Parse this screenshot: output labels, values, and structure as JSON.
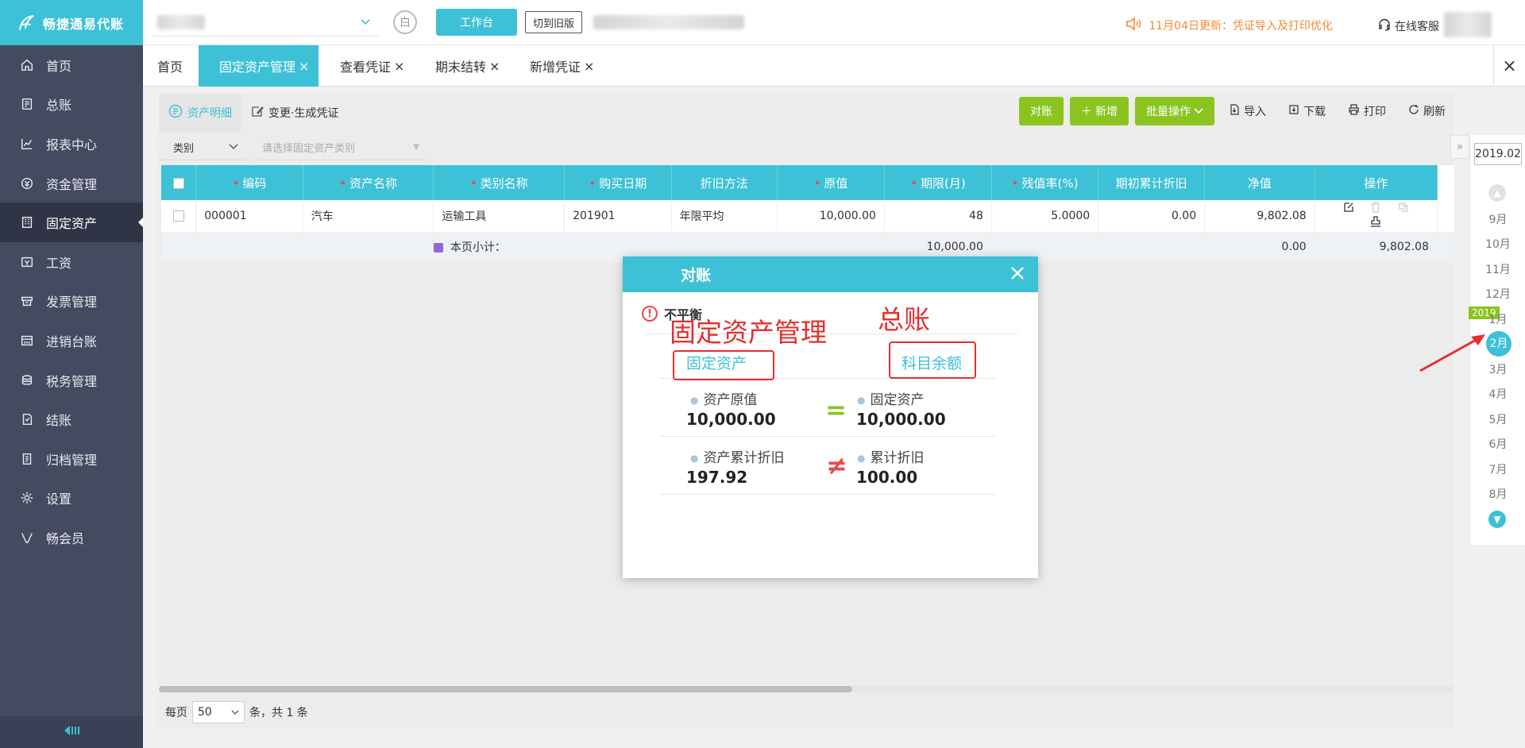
{
  "app": {
    "logo_text": "畅捷通易代账"
  },
  "sidebar": {
    "items": [
      {
        "label": "首页",
        "icon": "home-icon"
      },
      {
        "label": "总账",
        "icon": "ledger-icon"
      },
      {
        "label": "报表中心",
        "icon": "chart-icon"
      },
      {
        "label": "资金管理",
        "icon": "funds-icon"
      },
      {
        "label": "固定资产",
        "icon": "building-icon",
        "active": true
      },
      {
        "label": "工资",
        "icon": "salary-icon"
      },
      {
        "label": "发票管理",
        "icon": "invoice-icon"
      },
      {
        "label": "进销台账",
        "icon": "inventory-icon"
      },
      {
        "label": "税务管理",
        "icon": "tax-icon"
      },
      {
        "label": "结账",
        "icon": "checkout-icon"
      },
      {
        "label": "归档管理",
        "icon": "archive-icon"
      },
      {
        "label": "设置",
        "icon": "gear-icon"
      },
      {
        "label": "畅会员",
        "icon": "vip-icon"
      }
    ]
  },
  "header": {
    "circle_btn": "白",
    "workbench": "工作台",
    "old_version": "切到旧版",
    "notice": "11月04日更新：凭证导入及打印优化",
    "service": "在线客服"
  },
  "tabs": [
    {
      "label": "首页",
      "closable": false
    },
    {
      "label": "固定资产管理",
      "closable": true,
      "active": true
    },
    {
      "label": "查看凭证",
      "closable": true
    },
    {
      "label": "期末结转",
      "closable": true
    },
    {
      "label": "新增凭证",
      "closable": true
    }
  ],
  "subtabs": {
    "detail": "资产明细",
    "change": "变更·生成凭证"
  },
  "toolbar": {
    "reconcile": "对账",
    "add": "新增",
    "batch": "批量操作",
    "import": "导入",
    "download": "下载",
    "print": "打印",
    "refresh": "刷新"
  },
  "filter": {
    "type": "类别",
    "placeholder": "请选择固定资产类别"
  },
  "table": {
    "columns": [
      "编码",
      "资产名称",
      "类别名称",
      "购买日期",
      "折旧方法",
      "原值",
      "期限(月)",
      "残值率(%)",
      "期初累计折旧",
      "净值",
      "操作"
    ],
    "rows": [
      {
        "code": "000001",
        "name": "汽车",
        "category": "运输工具",
        "date": "201901",
        "method": "年限平均",
        "original": "10,000.00",
        "term": "48",
        "residual": "5.0000",
        "opening_dep": "0.00",
        "net": "9,802.08"
      }
    ],
    "subtotal": {
      "label": "本页小计：",
      "original": "10,000.00",
      "opening_dep": "0.00",
      "net": "9,802.08"
    }
  },
  "pager": {
    "prefix": "每页",
    "size": "50",
    "suffix": "条，共 1 条"
  },
  "period": {
    "current": "2019.02",
    "year_badge": "2019",
    "months": [
      "9月",
      "10月",
      "11月",
      "12月",
      "1月",
      "2月",
      "3月",
      "4月",
      "5月",
      "6月",
      "7月",
      "8月"
    ],
    "current_month": "2月"
  },
  "modal": {
    "title": "对账",
    "status": "不平衡",
    "left_head": "固定资产",
    "right_head": "科目余额",
    "rows": [
      {
        "left_label": "资产原值",
        "left_value": "10,000.00",
        "sign": "=",
        "right_label": "固定资产",
        "right_value": "10,000.00"
      },
      {
        "left_label": "资产累计折旧",
        "left_value": "197.92",
        "sign": "≠",
        "right_label": "累计折旧",
        "right_value": "100.00"
      }
    ]
  },
  "annotations": {
    "left": "固定资产管理",
    "right": "总账"
  },
  "colors": {
    "accent": "#3dc1d6",
    "sidebar": "#444a5f",
    "green": "#8bc41f",
    "warning": "#f28a32",
    "danger": "#e84a4a",
    "annotation": "#e62e2e"
  }
}
